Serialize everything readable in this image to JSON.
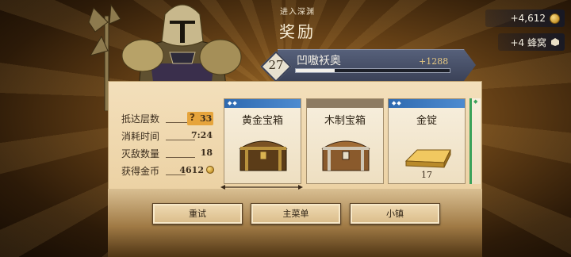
{
  "header": {
    "subtitle": "进入深渊",
    "title": "奖励"
  },
  "currency": {
    "gold_amount": "+4,612",
    "hive_amount": "+4 蜂窝",
    "gold_icon": "coin-icon"
  },
  "rank": {
    "level": "27",
    "player_name": "凹嗷袄奥",
    "xp_gain": "+1288",
    "xp_progress_percent": 25
  },
  "stats": {
    "floor_label": "抵达层数",
    "floor_value": "33",
    "floor_badge": "?",
    "time_label": "消耗时间",
    "time_value": "7:24",
    "kills_label": "灭敌数量",
    "kills_value": "18",
    "coins_label": "获得金币",
    "coins_value": "4612"
  },
  "rewards": [
    {
      "title": "黄金宝箱",
      "qty": "",
      "gems": "◆◆",
      "color": "#2f6ab0"
    },
    {
      "title": "木制宝箱",
      "qty": "",
      "gems": "",
      "color": "#8d7b62"
    },
    {
      "title": "金锭",
      "qty": "17",
      "gems": "◆◆",
      "color": "#2f6ab0"
    }
  ],
  "peek_card": {
    "gems": "◆",
    "color": "#3aa25a"
  },
  "buttons": {
    "retry": "重试",
    "main_menu": "主菜单",
    "town": "小镇"
  }
}
